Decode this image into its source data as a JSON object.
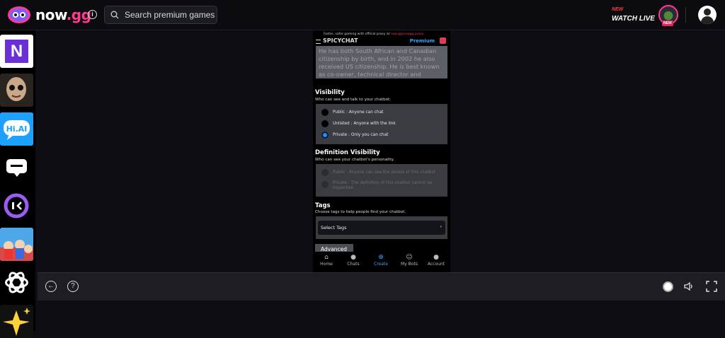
{
  "header": {
    "logo_text": "now",
    "logo_suffix": ".gg",
    "search_placeholder": "Search premium games",
    "watch_new": "NEW",
    "watch_live": "WATCH LIVE",
    "live_badge": "NEW"
  },
  "sidebar": {
    "apps": [
      {
        "name": "N",
        "bg": "#ffffff"
      },
      {
        "name": "horror-doll"
      },
      {
        "name": "Hi.AI",
        "bg": "#1ea0ff"
      },
      {
        "name": "chat-bubble"
      },
      {
        "name": "talkie"
      },
      {
        "name": "cartoon-game"
      },
      {
        "name": "openai-knot"
      },
      {
        "name": "sparkle-star"
      }
    ]
  },
  "game": {
    "proxy_text": "Faster, safer gaming with official proxy at ",
    "proxy_link": "now.gg/nowgg-proxy",
    "bot_title": "SPICYCHAT",
    "premium": "Premium",
    "bio": "He has both South African and Canadian citizenship by birth, and in 2002 he also received US citizenship. He is best known as co-owner, technical director and",
    "visibility": {
      "title": "Visibility",
      "subtitle": "Who can see and talk to your chatbot.",
      "options": [
        {
          "label": "Public : Anyone can chat",
          "selected": false
        },
        {
          "label": "Unlisted : Anyone with the link",
          "selected": false
        },
        {
          "label": "Private : Only you can chat",
          "selected": true
        }
      ]
    },
    "definition": {
      "title": "Definition Visibility",
      "subtitle": "Who can see your chatbot's personality.",
      "options": [
        {
          "label": "Public : Anyone can see the details of this chatbot."
        },
        {
          "label": "Private : The definition of this chatbot cannot be inspected."
        }
      ]
    },
    "tags": {
      "title": "Tags",
      "subtitle": "Choose tags to help people find your chatbot.",
      "select_label": "Select Tags"
    },
    "advanced_label": "Advanced",
    "nav": [
      {
        "label": "Home",
        "icon": "home-icon"
      },
      {
        "label": "Chats",
        "icon": "chats-icon"
      },
      {
        "label": "Create",
        "icon": "create-icon",
        "active": true
      },
      {
        "label": "My Bots",
        "icon": "bots-icon"
      },
      {
        "label": "Account",
        "icon": "account-icon"
      }
    ]
  },
  "colors": {
    "accent": "#ff3a8c",
    "link_blue": "#3fa2ff"
  }
}
